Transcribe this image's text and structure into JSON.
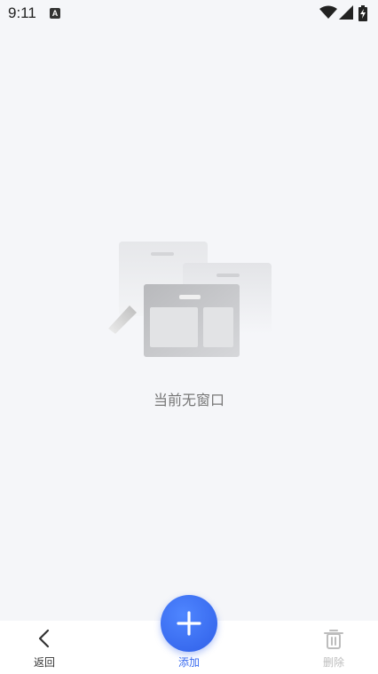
{
  "status_bar": {
    "time": "9:11",
    "notification_icon": "A",
    "icons": [
      "wifi-icon",
      "cell-signal-icon",
      "battery-charging-icon"
    ]
  },
  "empty_state": {
    "message": "当前无窗口",
    "illustration": "windows-illustration-icon"
  },
  "bottom_bar": {
    "back_label": "返回",
    "add_label": "添加",
    "delete_label": "删除"
  },
  "colors": {
    "background": "#f5f6f9",
    "accent": "#3b6cf0",
    "disabled": "#bdbdbd"
  }
}
